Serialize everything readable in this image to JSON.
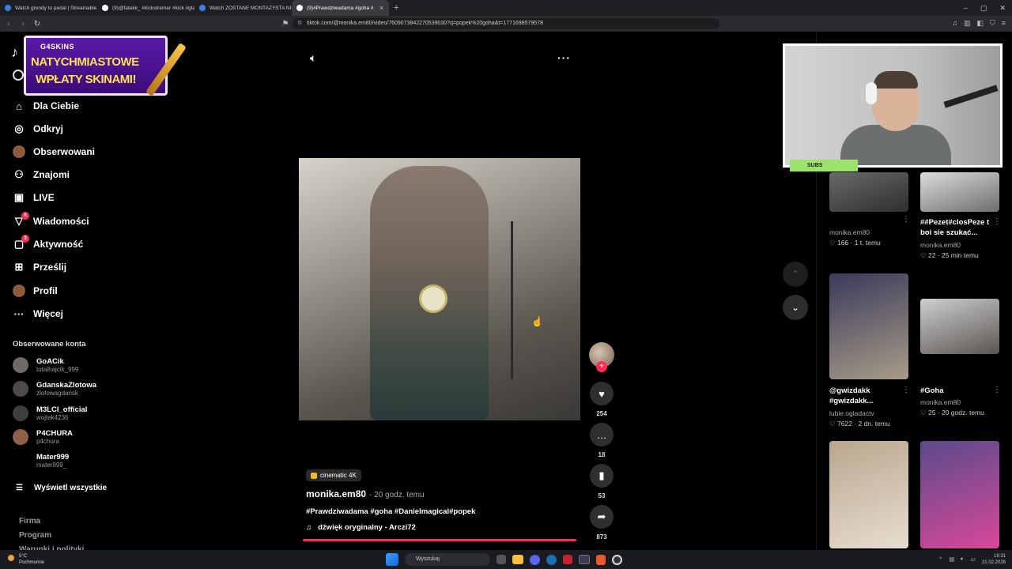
{
  "browser": {
    "tabs": [
      {
        "title": "Watch grendy to pedal | Streamable",
        "color": "#3d7de8",
        "active": false
      },
      {
        "title": "(9)@fatekk_ #kickstremer #kick #gta",
        "color": "#ffffff",
        "active": false
      },
      {
        "title": "Watch ZOSTANE MONTAZYSTA NIE!!",
        "color": "#3d7de8",
        "active": false
      },
      {
        "title": "(9)#Prawdziwadama #goha #",
        "color": "#ffffff",
        "active": true
      }
    ],
    "url": "tiktok.com/@monika.em80/video/7609073842270539030?q=popek%20goha&t=1771698579578"
  },
  "promo": {
    "brand": "G4SKINS",
    "line1": "NATYCHMIASTOWE",
    "line2": "WPŁATY SKINAMI!"
  },
  "sidebar": {
    "nav": [
      {
        "label": "Dla Ciebie",
        "icon": "home-icon",
        "glyph": "⌂",
        "badge": ""
      },
      {
        "label": "Odkryj",
        "icon": "compass-icon",
        "glyph": "◎",
        "badge": ""
      },
      {
        "label": "Obserwowani",
        "icon": "following-avatar-icon",
        "glyph": "●",
        "badge": ""
      },
      {
        "label": "Znajomi",
        "icon": "friends-icon",
        "glyph": "⚇",
        "badge": ""
      },
      {
        "label": "LIVE",
        "icon": "live-icon",
        "glyph": "▣",
        "badge": ""
      },
      {
        "label": "Wiadomości",
        "icon": "inbox-icon",
        "glyph": "▽",
        "badge": "6"
      },
      {
        "label": "Aktywność",
        "icon": "activity-icon",
        "glyph": "▢",
        "badge": "3"
      },
      {
        "label": "Prześlij",
        "icon": "upload-icon",
        "glyph": "⊞",
        "badge": ""
      },
      {
        "label": "Profil",
        "icon": "profile-avatar-icon",
        "glyph": "●",
        "badge": ""
      },
      {
        "label": "Więcej",
        "icon": "more-icon",
        "glyph": "···",
        "badge": ""
      }
    ],
    "followed_title": "Obserwowane konta",
    "accounts": [
      {
        "name": "GoACik",
        "handle": "totalhajcik_999",
        "color": "#6f6a66"
      },
      {
        "name": "GdanskaZlotowa",
        "handle": "zlotowagdansk",
        "color": "#4d4a48"
      },
      {
        "name": "M3LCI_official",
        "handle": "wojtek4236",
        "color": "#3e3e3e"
      },
      {
        "name": "P4CHURA",
        "handle": "p4chura",
        "color": "#8d6048"
      },
      {
        "name": "Mater999",
        "handle": "mater999_",
        "color": "#000000"
      }
    ],
    "show_all": "Wyświetl wszystkie",
    "footer": [
      "Firma",
      "Program",
      "Warunki i polityki"
    ]
  },
  "video": {
    "stats": {
      "likes": "254",
      "comments": "18",
      "saves": "53",
      "shares": "873"
    },
    "effect_tag": "cinematic 4K",
    "author": "monika.em80",
    "time": "· 20 godz. temu",
    "hashtags": "#Prawdziwadama #goha #Danielmagical#popek",
    "sound": "dźwięk oryginalny - Arczi72"
  },
  "webcam": {
    "label": "SUBS"
  },
  "related": [
    {
      "title": "",
      "author": "monika.em80",
      "stats": "♡ 166 · 1 t. temu",
      "thumb": [
        "#6a6a6a",
        "#2e2e2e"
      ]
    },
    {
      "title": "##Pezet#closPeze t boi sie szukać...",
      "author": "monika.em80",
      "stats": "♡ 22 · 25 min temu",
      "thumb": [
        "#dcdcdc",
        "#6e6e6e"
      ]
    },
    {
      "title": "@gwizdakk #gwizdakk...",
      "author": "lubie.ogladactv",
      "stats": "♡ 7622 · 2 dn. temu",
      "thumb": [
        "#3a3a5a",
        "#a89c88"
      ]
    },
    {
      "title": "#Goha",
      "author": "monika.em80",
      "stats": "♡ 25 · 20 godz. temu",
      "thumb": [
        "#cfcfcf",
        "#5a5552"
      ]
    },
    {
      "title": "",
      "author": "",
      "stats": "",
      "thumb": [
        "#bba68e",
        "#e6ddd1"
      ]
    },
    {
      "title": "",
      "author": "",
      "stats": "",
      "thumb": [
        "#5a4b8a",
        "#d8489a"
      ]
    }
  ],
  "taskbar": {
    "temp": "5°C",
    "weather": "Pochmurnie",
    "search": "Wyszukaj",
    "time": "19:31",
    "date": "21.02.2026"
  }
}
